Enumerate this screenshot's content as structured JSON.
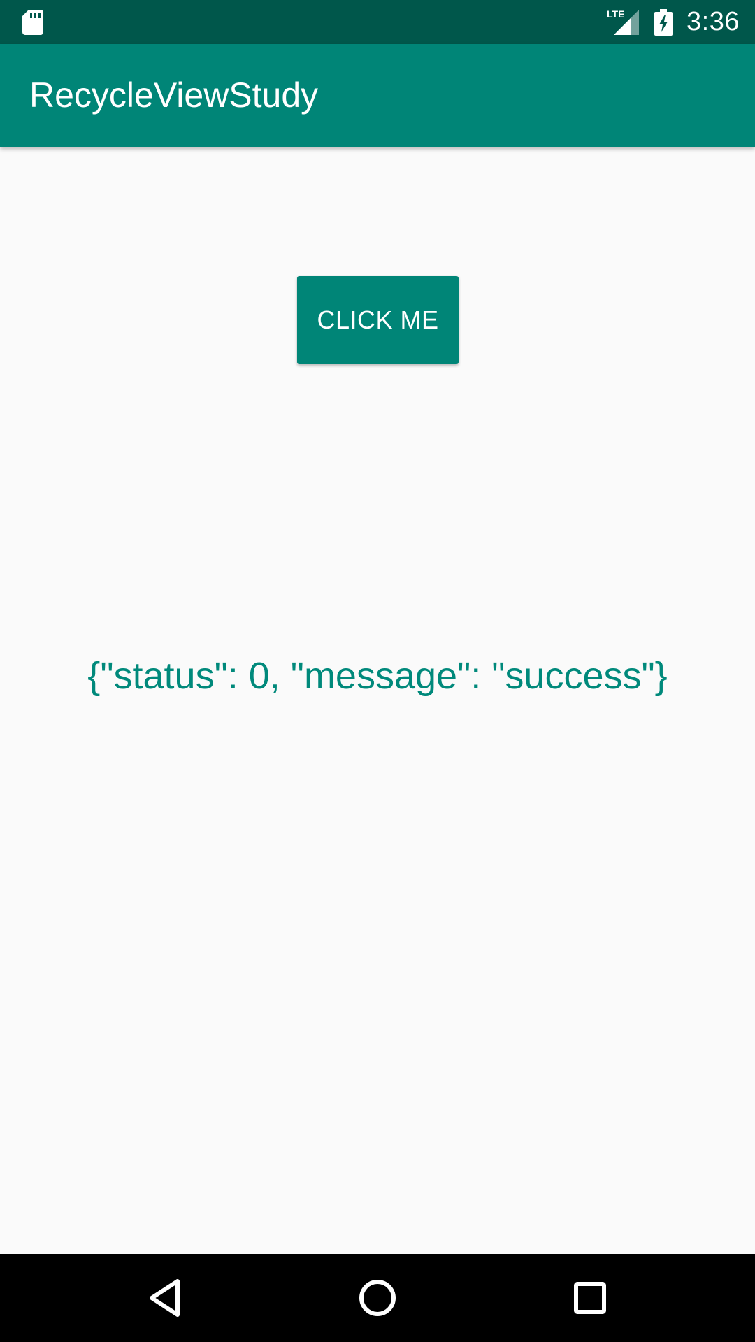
{
  "status_bar": {
    "time": "3:36",
    "network": "LTE",
    "icons": [
      "sd-card-icon",
      "lte-signal-icon",
      "battery-charging-icon"
    ]
  },
  "app_bar": {
    "title": "RecycleViewStudy",
    "color": "#008577"
  },
  "main": {
    "button_label": "CLICK ME",
    "response_text": "{\"status\": 0, \"message\": \"success\"}",
    "accent_color": "#008577",
    "text_color": "#00897b"
  },
  "nav_bar": {
    "icons": [
      "back-icon",
      "home-icon",
      "recents-icon"
    ]
  },
  "colors": {
    "status_bar": "#00574b",
    "app_bar": "#008577",
    "background": "#fafafa"
  }
}
